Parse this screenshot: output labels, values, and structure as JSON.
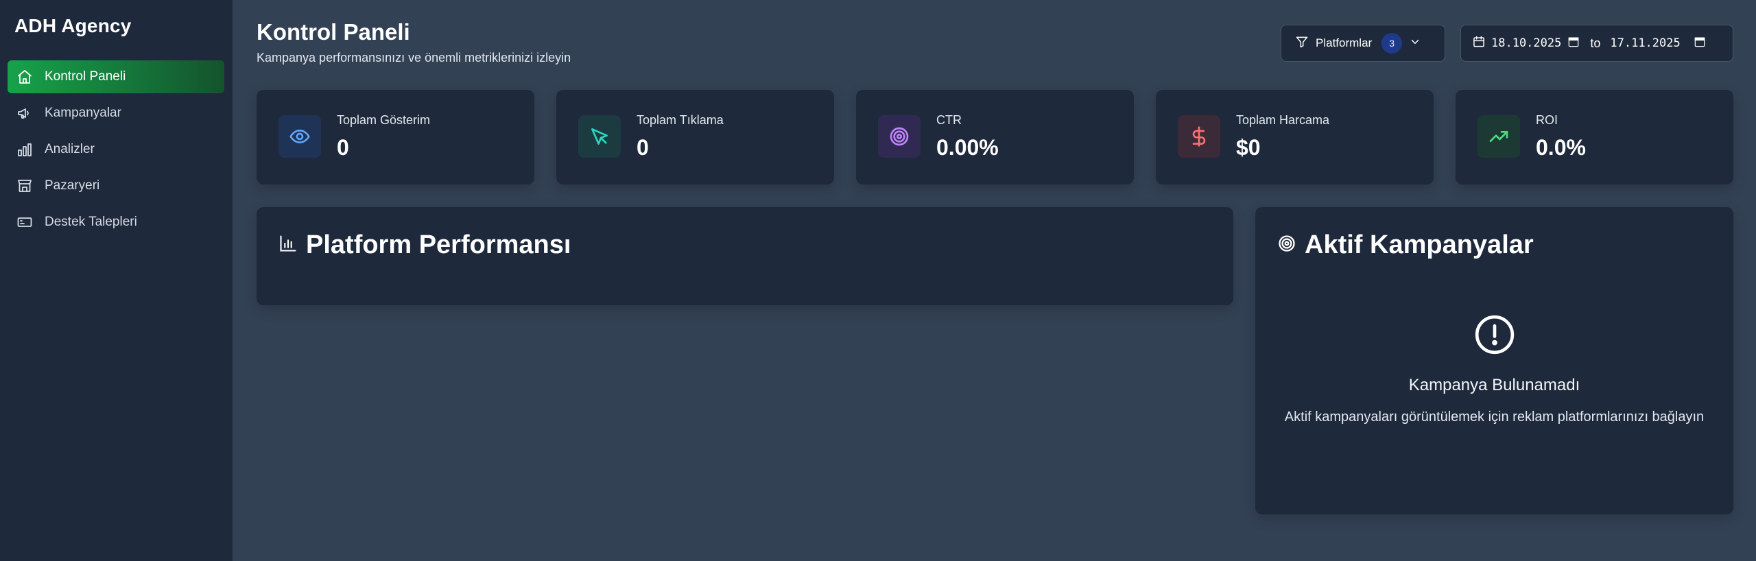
{
  "sidebar": {
    "brand": "ADH Agency",
    "items": [
      {
        "label": "Kontrol Paneli",
        "icon": "home-icon",
        "active": true
      },
      {
        "label": "Kampanyalar",
        "icon": "megaphone-icon",
        "active": false
      },
      {
        "label": "Analizler",
        "icon": "bar-chart-icon",
        "active": false
      },
      {
        "label": "Pazaryeri",
        "icon": "store-icon",
        "active": false
      },
      {
        "label": "Destek Talepleri",
        "icon": "ticket-icon",
        "active": false
      }
    ],
    "accent": "#16a34a"
  },
  "header": {
    "title": "Kontrol Paneli",
    "subtitle": "Kampanya performansınızı ve önemli metriklerinizi izleyin"
  },
  "filters": {
    "platforms_label": "Platformlar",
    "platforms_count": "3",
    "date_from": "18.10.2025",
    "date_sep": "to",
    "date_to": "17.11.2025"
  },
  "stats": [
    {
      "label": "Toplam Gösterim",
      "value": "0",
      "icon": "eye-icon",
      "color": "#60a5fa"
    },
    {
      "label": "Toplam Tıklama",
      "value": "0",
      "icon": "cursor-icon",
      "color": "#2dd4bf"
    },
    {
      "label": "CTR",
      "value": "0.00%",
      "icon": "target-icon",
      "color": "#c084fc"
    },
    {
      "label": "Toplam Harcama",
      "value": "$0",
      "icon": "dollar-icon",
      "color": "#f87171"
    },
    {
      "label": "ROI",
      "value": "0.0%",
      "icon": "trending-up-icon",
      "color": "#4ade80"
    }
  ],
  "platform_panel": {
    "title": "Platform Performansı",
    "icon": "bar-chart-icon"
  },
  "campaign_panel": {
    "title": "Aktif Kampanyalar",
    "icon": "target-icon",
    "empty_title": "Kampanya Bulunamadı",
    "empty_desc": "Aktif kampanyaları görüntülemek için reklam platformlarınızı bağlayın",
    "empty_icon": "alert-circle-icon"
  }
}
